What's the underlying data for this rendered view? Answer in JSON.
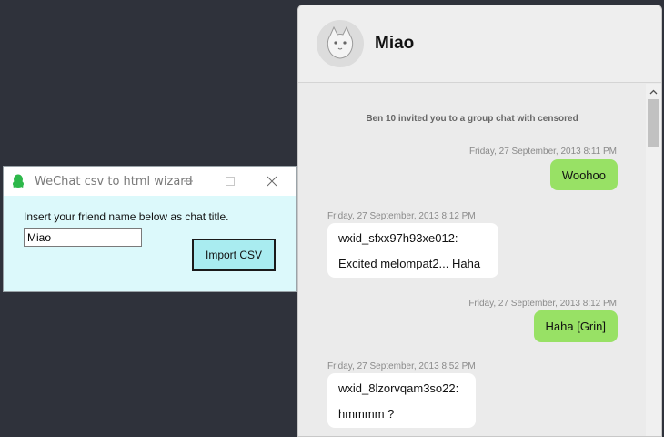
{
  "wizard": {
    "title": "WeChat csv to html wizard",
    "prompt": "Insert your friend name below as chat title.",
    "name_value": "Miao",
    "import_label": "Import CSV",
    "icons": {
      "app": "qq-penguin-icon",
      "minimize": "minimize-icon",
      "maximize": "maximize-icon",
      "close": "close-icon"
    }
  },
  "chat": {
    "title": "Miao",
    "avatar_icon": "cat-avatar-icon",
    "system_message": "Ben 10 invited you to a group chat with censored",
    "messages": [
      {
        "direction": "out",
        "timestamp": "Friday, 27 September, 2013 8:11 PM",
        "text": "Woohoo"
      },
      {
        "direction": "in",
        "timestamp": "Friday, 27 September, 2013 8:12 PM",
        "sender": "wxid_sfxx97h93xe012:",
        "text": "Excited melompat2... Haha"
      },
      {
        "direction": "out",
        "timestamp": "Friday, 27 September, 2013 8:12 PM",
        "text": "Haha [Grin]"
      },
      {
        "direction": "in",
        "timestamp": "Friday, 27 September, 2013 8:52 PM",
        "sender": "wxid_8lzorvqam3so22:",
        "text": "hmmmm ?"
      }
    ]
  },
  "colors": {
    "desktop": "#2f323b",
    "dialog_bg": "#dcf9fb",
    "button_bg": "#a9ecf0",
    "outgoing_bubble": "#98e165",
    "incoming_bubble": "#ffffff",
    "chat_bg": "#ebebeb"
  }
}
